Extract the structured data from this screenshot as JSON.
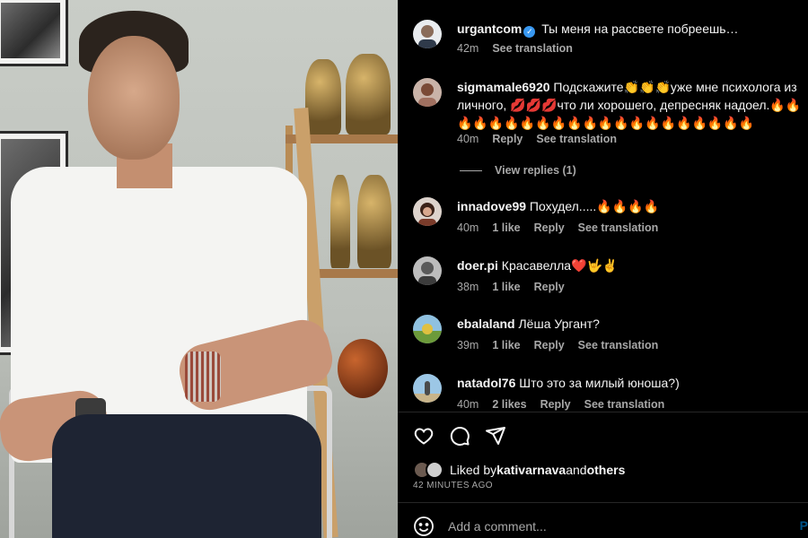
{
  "photo": {
    "alt_icon": "post-photo"
  },
  "comments": [
    {
      "user": "urgantcom",
      "verified": true,
      "text": "Ты меня на рассвете побреешь…",
      "time": "42m",
      "likes": "",
      "reply": "",
      "translate": "See translation",
      "avatar_color": "#6b8fb8"
    },
    {
      "user": "sigmamale6920",
      "verified": false,
      "text": "Подскажите👏👏👏уже мне психолога из личного, 💋💋💋что ли хорошего, депресняк надоел.🔥🔥🔥🔥🔥🔥🔥🔥🔥🔥🔥🔥🔥🔥🔥🔥🔥🔥🔥🔥🔥",
      "time": "40m",
      "likes": "",
      "reply": "Reply",
      "translate": "See translation",
      "avatar_color": "#b08070"
    },
    {
      "user": "innadove99",
      "verified": false,
      "text": "Похудел.....🔥🔥🔥🔥",
      "time": "40m",
      "likes": "1 like",
      "reply": "Reply",
      "translate": "See translation",
      "avatar_color": "#5a3a2c"
    },
    {
      "user": "doer.pi",
      "verified": false,
      "text": "Красавелла❤️🤟✌️",
      "time": "38m",
      "likes": "1 like",
      "reply": "Reply",
      "translate": "",
      "avatar_color": "#8a8a8a"
    },
    {
      "user": "ebalaland",
      "verified": false,
      "text": "Лёша Ургант?",
      "time": "39m",
      "likes": "1 like",
      "reply": "Reply",
      "translate": "See translation",
      "avatar_color": "#7fa85a"
    },
    {
      "user": "natadol76",
      "verified": false,
      "text": "Што это за милый юноша?)",
      "time": "40m",
      "likes": "2 likes",
      "reply": "Reply",
      "translate": "See translation",
      "avatar_color": "#6f9fc8"
    }
  ],
  "view_replies": "View replies (1)",
  "actions": {
    "like_icon": "heart-icon",
    "comment_icon": "comment-icon",
    "share_icon": "share-icon"
  },
  "liked_by": {
    "prefix": "Liked by ",
    "user": "kativarnava",
    "middle": " and ",
    "others": "others"
  },
  "post_time": "42 MINUTES AGO",
  "add_comment": {
    "placeholder": "Add a comment...",
    "post_label": "P"
  }
}
